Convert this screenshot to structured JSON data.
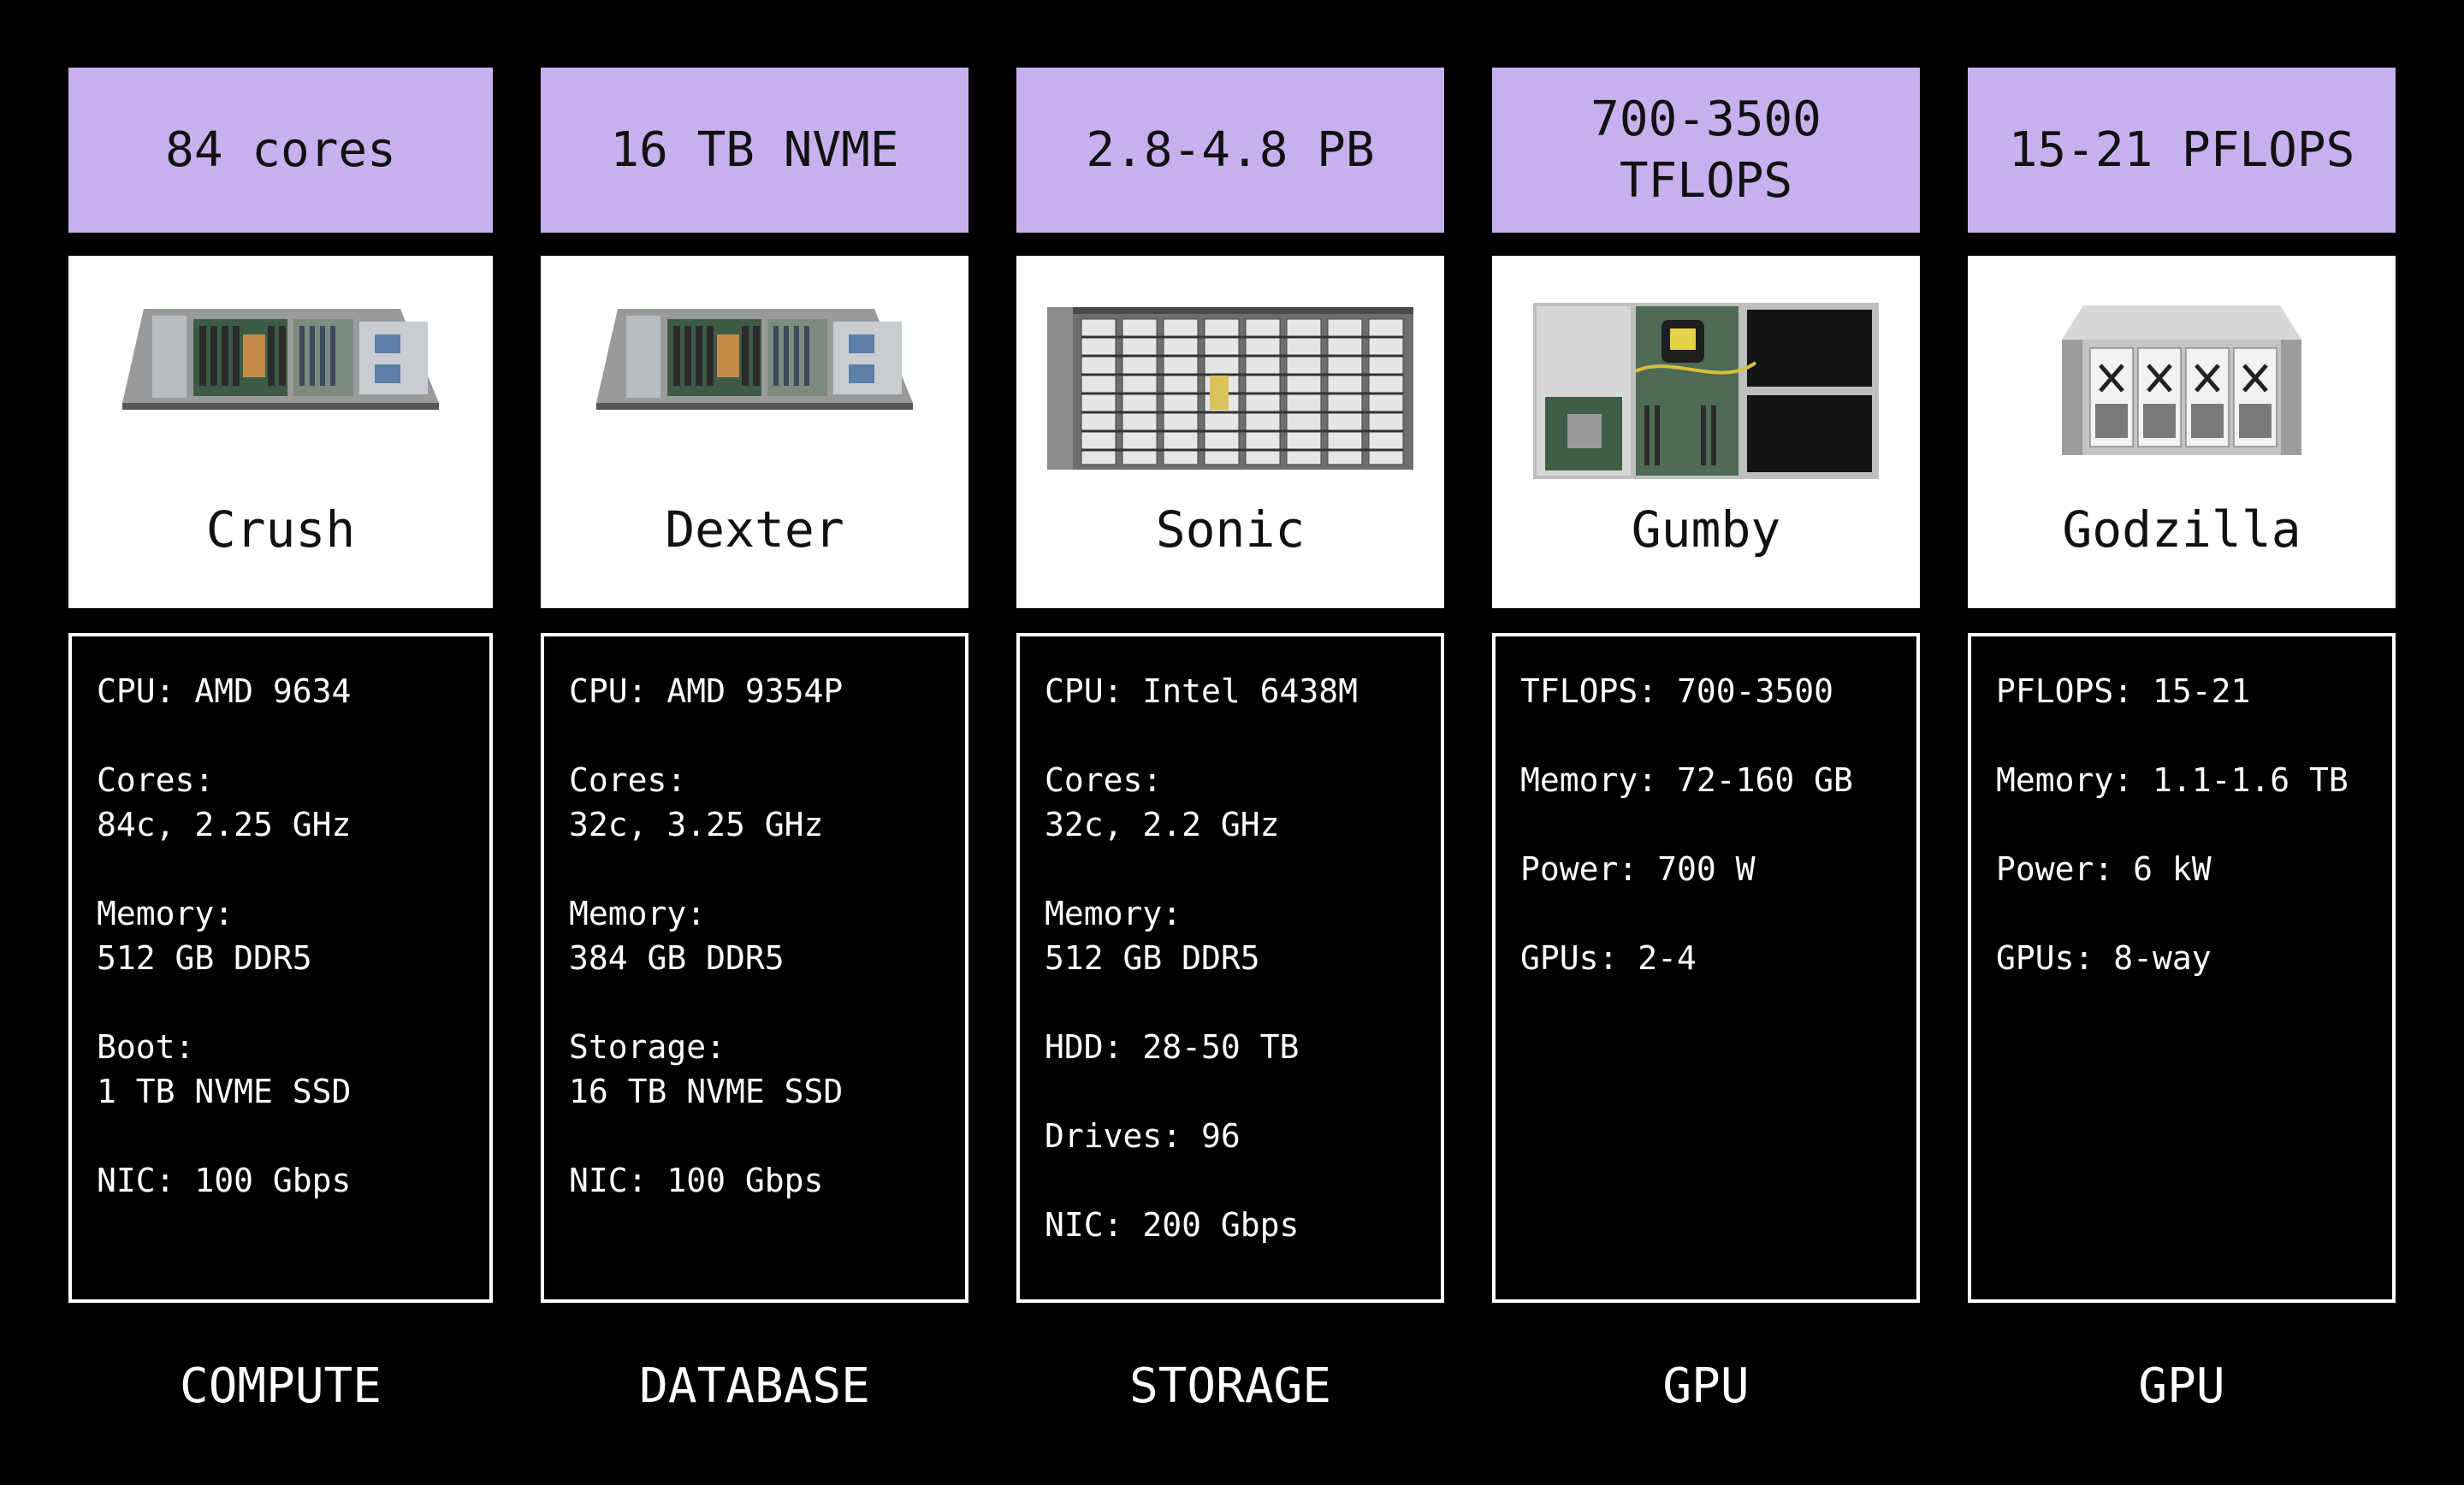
{
  "columns": [
    {
      "headline": "84 cores",
      "server_name": "Crush",
      "image_icon": "rack-server-1u-icon",
      "specs": [
        "CPU: AMD 9634",
        "",
        "Cores:",
        "84c, 2.25 GHz",
        "",
        "Memory:",
        "512 GB DDR5",
        "",
        "Boot:",
        "1 TB NVME SSD",
        "",
        "NIC: 100 Gbps"
      ],
      "category": "COMPUTE"
    },
    {
      "headline": "16 TB NVME",
      "server_name": "Dexter",
      "image_icon": "rack-server-1u-icon",
      "specs": [
        "CPU: AMD 9354P",
        "",
        "Cores:",
        "32c, 3.25 GHz",
        "",
        "Memory:",
        "384 GB DDR5",
        "",
        "Storage:",
        "16 TB NVME SSD",
        "",
        "NIC: 100 Gbps"
      ],
      "category": "DATABASE"
    },
    {
      "headline": "2.8-4.8 PB",
      "server_name": "Sonic",
      "image_icon": "storage-chassis-icon",
      "specs": [
        "CPU: Intel 6438M",
        "",
        "Cores:",
        "32c, 2.2 GHz",
        "",
        "Memory:",
        "512 GB DDR5",
        "",
        "HDD: 28-50 TB",
        "",
        "Drives: 96",
        "",
        "NIC: 200 Gbps"
      ],
      "category": "STORAGE"
    },
    {
      "headline": "700-3500\nTFLOPS",
      "server_name": "Gumby",
      "image_icon": "gpu-server-icon",
      "specs": [
        "TFLOPS: 700-3500",
        "",
        "Memory: 72-160 GB",
        "",
        "Power: 700 W",
        "",
        "GPUs: 2-4"
      ],
      "category": "GPU"
    },
    {
      "headline": "15-21 PFLOPS",
      "server_name": "Godzilla",
      "image_icon": "gpu-chassis-icon",
      "specs": [
        "PFLOPS: 15-21",
        "",
        "Memory: 1.1-1.6 TB",
        "",
        "Power: 6 kW",
        "",
        "GPUs: 8-way"
      ],
      "category": "GPU"
    }
  ],
  "colors": {
    "background": "#000000",
    "header_fill": "#c6b1ee",
    "card_fill": "#ffffff",
    "border": "#ffffff"
  }
}
